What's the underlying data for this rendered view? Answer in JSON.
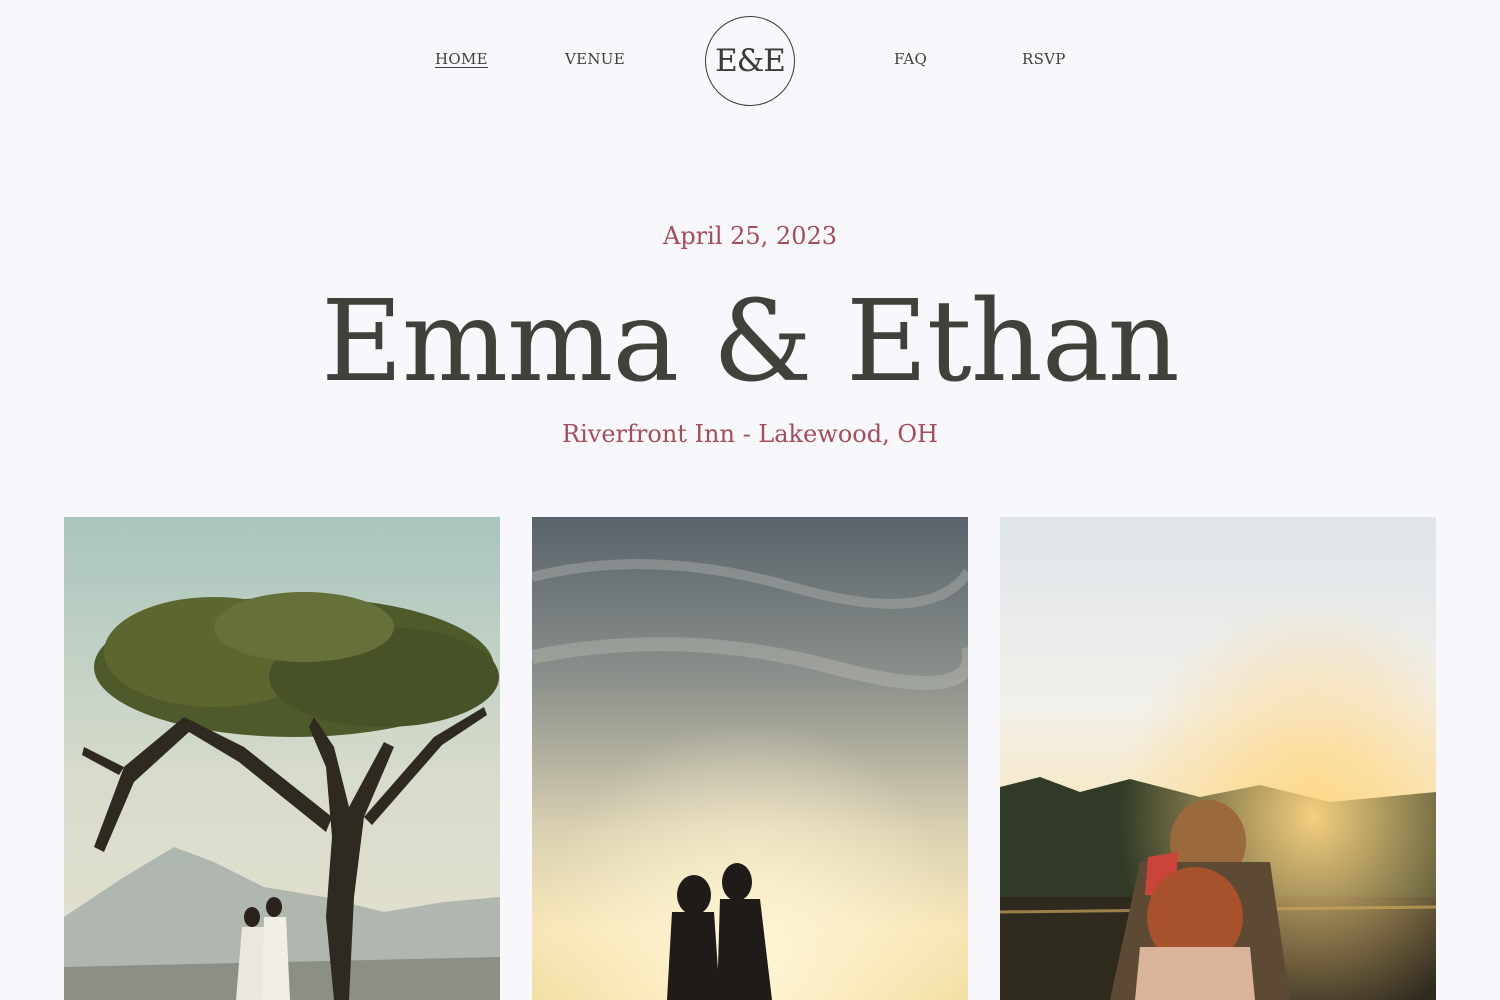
{
  "nav": {
    "home": "HOME",
    "venue": "VENUE",
    "monogram": "E&E",
    "faq": "FAQ",
    "rsvp": "RSVP"
  },
  "hero": {
    "date": "April 25, 2023",
    "names": "Emma & Ethan",
    "location": "Riverfront Inn - Lakewood, OH"
  },
  "gallery": [
    {
      "name": "couple-under-tree-photo"
    },
    {
      "name": "couple-silhouette-sunset-photo"
    },
    {
      "name": "couple-lakeside-sunset-photo"
    }
  ],
  "colors": {
    "background": "#f8f7fc",
    "text_dark": "#40413a",
    "accent": "#a54d58"
  }
}
